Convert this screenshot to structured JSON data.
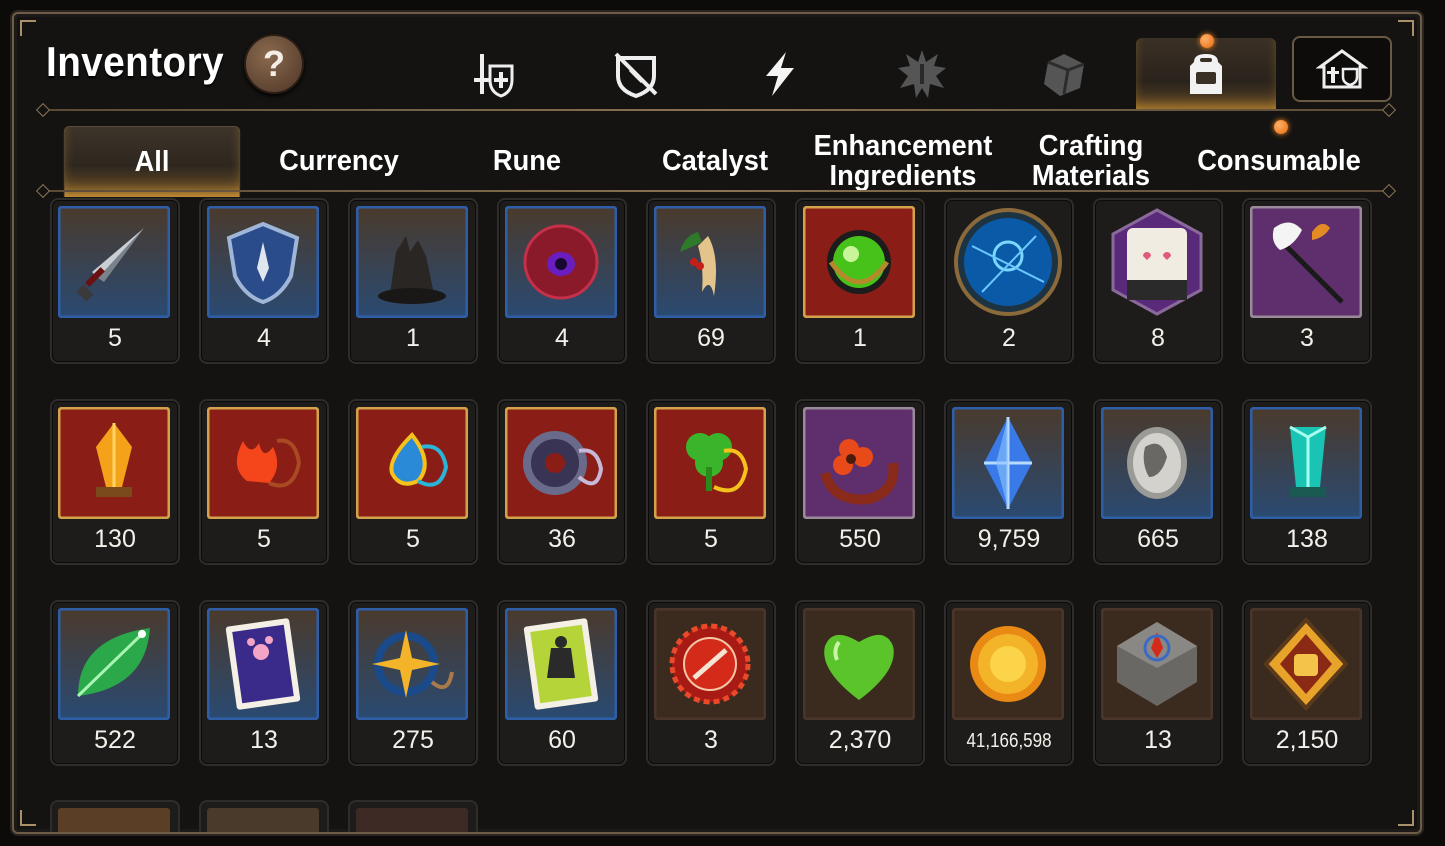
{
  "header": {
    "title": "Inventory",
    "help_label": "?"
  },
  "top_tabs": [
    {
      "icon": "sword-shield-icon",
      "active": false
    },
    {
      "icon": "broken-shield-icon",
      "active": false
    },
    {
      "icon": "lightning-icon",
      "active": false
    },
    {
      "icon": "spiky-emblem-icon",
      "active": false
    },
    {
      "icon": "cube-icon",
      "active": false
    },
    {
      "icon": "backpack-icon",
      "active": true,
      "notification": true
    }
  ],
  "top_right_button": {
    "icon": "house-storage-icon"
  },
  "sub_tabs": [
    {
      "label": "All",
      "active": true
    },
    {
      "label": "Currency",
      "active": false
    },
    {
      "label": "Rune",
      "active": false
    },
    {
      "label": "Catalyst",
      "active": false
    },
    {
      "label": "Enhancement\nIngredients",
      "active": false
    },
    {
      "label": "Crafting\nMaterials",
      "active": false
    },
    {
      "label": "Consumable",
      "active": false,
      "notification": true
    }
  ],
  "items": [
    {
      "icon": "sword-icon",
      "count": "5",
      "frame": "blue"
    },
    {
      "icon": "shield-icon",
      "count": "4",
      "frame": "blue"
    },
    {
      "icon": "burnt-stump-icon",
      "count": "1",
      "frame": "blue"
    },
    {
      "icon": "eye-orb-icon",
      "count": "4",
      "frame": "blue"
    },
    {
      "icon": "ginseng-root-icon",
      "count": "69",
      "frame": "blue"
    },
    {
      "icon": "green-gem-icon",
      "count": "1",
      "frame": "red"
    },
    {
      "icon": "blue-rune-disc-icon",
      "count": "2",
      "frame": "round"
    },
    {
      "icon": "pet-food-bag-icon",
      "count": "8",
      "frame": "hex"
    },
    {
      "icon": "feather-wand-icon",
      "count": "3",
      "frame": "purple"
    },
    {
      "icon": "amber-crystal-icon",
      "count": "130",
      "frame": "red"
    },
    {
      "icon": "flame-pendant-icon",
      "count": "5",
      "frame": "red"
    },
    {
      "icon": "water-pendant-icon",
      "count": "5",
      "frame": "red"
    },
    {
      "icon": "ring-pendant-icon",
      "count": "36",
      "frame": "red"
    },
    {
      "icon": "clover-pendant-icon",
      "count": "5",
      "frame": "red"
    },
    {
      "icon": "flower-bangle-icon",
      "count": "550",
      "frame": "purple"
    },
    {
      "icon": "blue-crystal-icon",
      "count": "9,759",
      "frame": "blue"
    },
    {
      "icon": "silver-coin-icon",
      "count": "665",
      "frame": "blue"
    },
    {
      "icon": "teal-crystal-icon",
      "count": "138",
      "frame": "blue"
    },
    {
      "icon": "green-leaf-icon",
      "count": "522",
      "frame": "blue"
    },
    {
      "icon": "paw-ticket-icon",
      "count": "13",
      "frame": "blue"
    },
    {
      "icon": "star-amulet-icon",
      "count": "275",
      "frame": "blue"
    },
    {
      "icon": "outfit-ticket-icon",
      "count": "60",
      "frame": "blue"
    },
    {
      "icon": "red-medal-icon",
      "count": "3",
      "frame": "brown"
    },
    {
      "icon": "green-heart-icon",
      "count": "2,370",
      "frame": "brown"
    },
    {
      "icon": "gold-coin-icon",
      "count": "41,166,598",
      "frame": "brown",
      "small": true
    },
    {
      "icon": "stone-compass-icon",
      "count": "13",
      "frame": "brown"
    },
    {
      "icon": "fist-emblem-icon",
      "count": "2,150",
      "frame": "brown"
    }
  ],
  "colors": {
    "frame_blue": "#2f5ea8",
    "frame_red": "#9a1f18",
    "frame_purple": "#6b3479",
    "frame_brown": "#3b2a1e",
    "accent_gold": "#e0a23a"
  }
}
